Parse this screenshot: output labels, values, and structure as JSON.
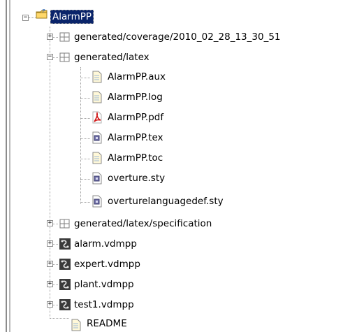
{
  "tree": {
    "root": {
      "label": "AlarmPP",
      "icon": "project-folder-icon",
      "expanded": true,
      "selected": true
    },
    "children": [
      {
        "label": "generated/coverage/2010_02_28_13_30_51",
        "icon": "package-folder-icon",
        "expander": "+"
      },
      {
        "label": "generated/latex",
        "icon": "package-folder-icon",
        "expander": "-",
        "children": [
          {
            "label": "AlarmPP.aux",
            "icon": "text-file-icon"
          },
          {
            "label": "AlarmPP.log",
            "icon": "text-file-icon"
          },
          {
            "label": "AlarmPP.pdf",
            "icon": "pdf-file-icon"
          },
          {
            "label": "AlarmPP.tex",
            "icon": "tex-file-icon"
          },
          {
            "label": "AlarmPP.toc",
            "icon": "text-file-icon"
          },
          {
            "label": "overture.sty",
            "icon": "tex-file-icon"
          },
          {
            "label": "overturelanguagedef.sty",
            "icon": "tex-file-icon"
          }
        ]
      },
      {
        "label": "generated/latex/specification",
        "icon": "package-folder-icon",
        "expander": "+"
      },
      {
        "label": "alarm.vdmpp",
        "icon": "vdm-file-icon",
        "expander": "+"
      },
      {
        "label": "expert.vdmpp",
        "icon": "vdm-file-icon",
        "expander": "+"
      },
      {
        "label": "plant.vdmpp",
        "icon": "vdm-file-icon",
        "expander": "+"
      },
      {
        "label": "test1.vdmpp",
        "icon": "vdm-file-icon",
        "expander": "+"
      },
      {
        "label": "README",
        "icon": "text-file-icon"
      }
    ]
  }
}
